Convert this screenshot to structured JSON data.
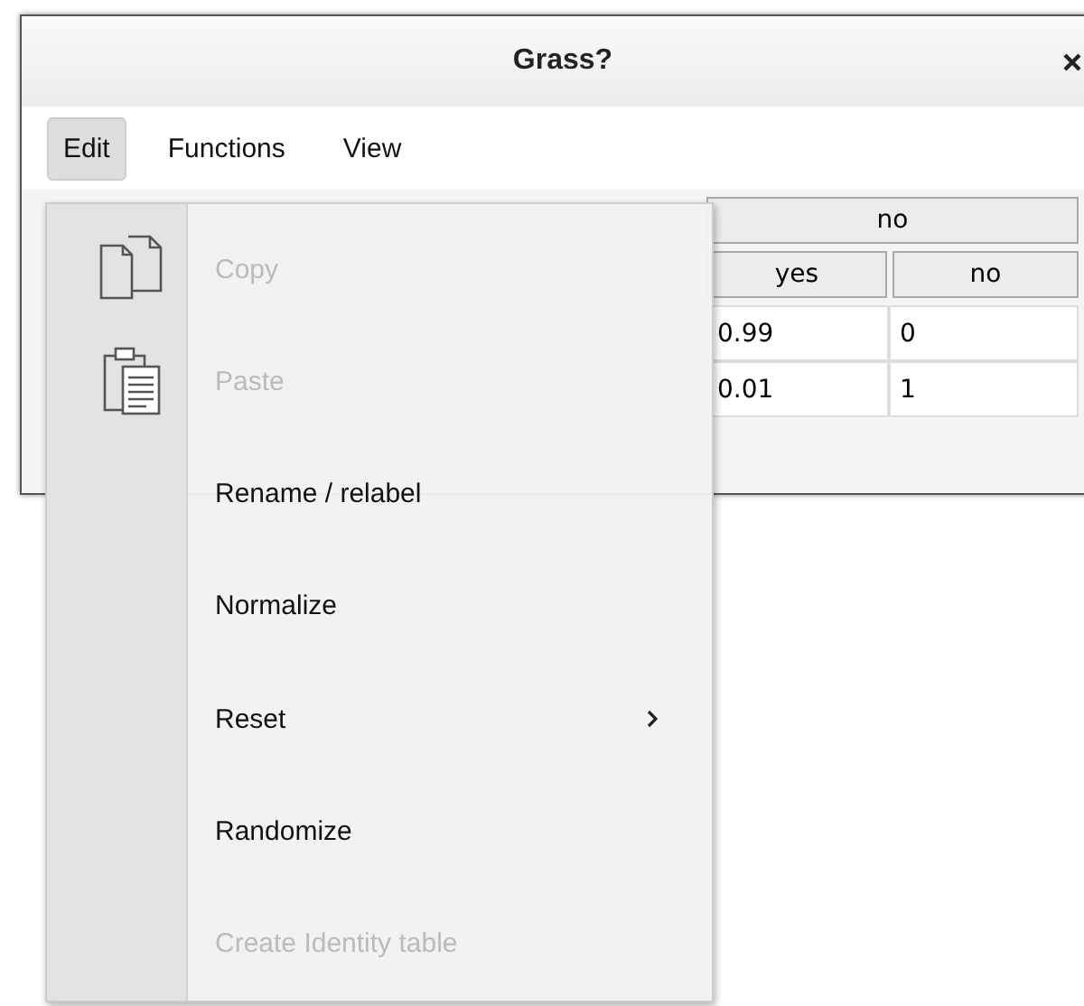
{
  "window": {
    "title": "Grass?"
  },
  "menubar": [
    {
      "label": "Edit",
      "selected": true
    },
    {
      "label": "Functions",
      "selected": false
    },
    {
      "label": "View",
      "selected": false
    }
  ],
  "table": {
    "header_groups": [
      "no"
    ],
    "columns": [
      "yes",
      "no"
    ],
    "rows": [
      [
        "0.99",
        "0"
      ],
      [
        "0.01",
        "1"
      ]
    ]
  },
  "menu": {
    "items": [
      {
        "label": "Copy",
        "disabled": true,
        "submenu": false
      },
      {
        "label": "Paste",
        "disabled": true,
        "submenu": false
      },
      {
        "label": "Rename / relabel",
        "disabled": false,
        "submenu": false
      },
      {
        "label": "Normalize",
        "disabled": false,
        "submenu": false
      },
      {
        "label": "Reset",
        "disabled": false,
        "submenu": true
      },
      {
        "label": "Randomize",
        "disabled": false,
        "submenu": false
      },
      {
        "label": "Create Identity table",
        "disabled": true,
        "submenu": false
      }
    ]
  }
}
